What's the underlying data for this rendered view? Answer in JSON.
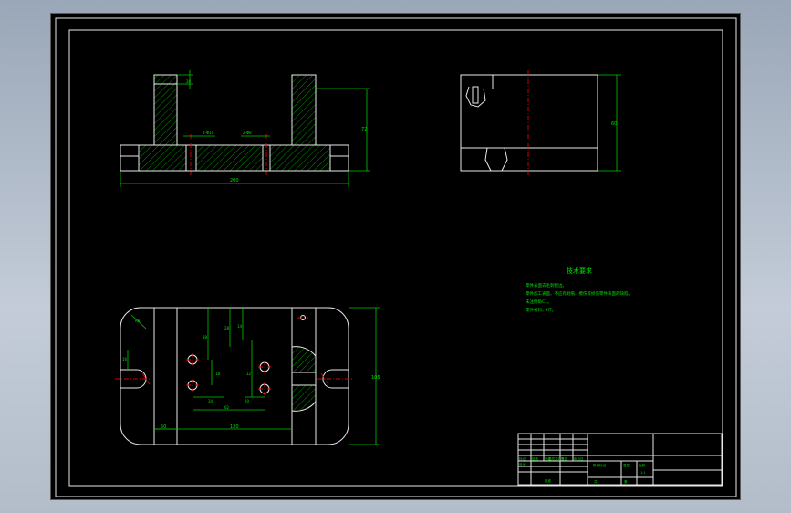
{
  "drawing": {
    "tech_req_title": "技术要求",
    "tech_req_lines": [
      "零件表面去毛刺锐边。",
      "零件加工表面，不应有划痕、擦伤等损伤零件表面的缺陷。",
      "未注倒角C1。",
      "零件材料，HT。"
    ],
    "dims_front": {
      "overall_width": "200",
      "height": "72",
      "hole1": "2-Φ10",
      "hole2": "2-Φ8",
      "top_thick": "20"
    },
    "dims_side": {
      "height": "60"
    },
    "dims_plan": {
      "radius": "R8",
      "d1": "38",
      "d2": "28",
      "d3": "14",
      "d4": "12",
      "d5": "18",
      "d6": "20",
      "d7": "34",
      "d8": "62",
      "d9": "130",
      "d10": "50",
      "d11": "105",
      "d12": "16"
    },
    "title_block": {
      "row_labels": [
        "标记",
        "处数",
        "分区",
        "更改文件号",
        "签名",
        "年月日"
      ],
      "design": "设计",
      "approve": "批准",
      "stage_label": "阶段标记",
      "weight_label": "重量",
      "scale_label": "比例",
      "scale_value": "1:1",
      "sheet_total": "共",
      "sheet_no": "第"
    }
  }
}
